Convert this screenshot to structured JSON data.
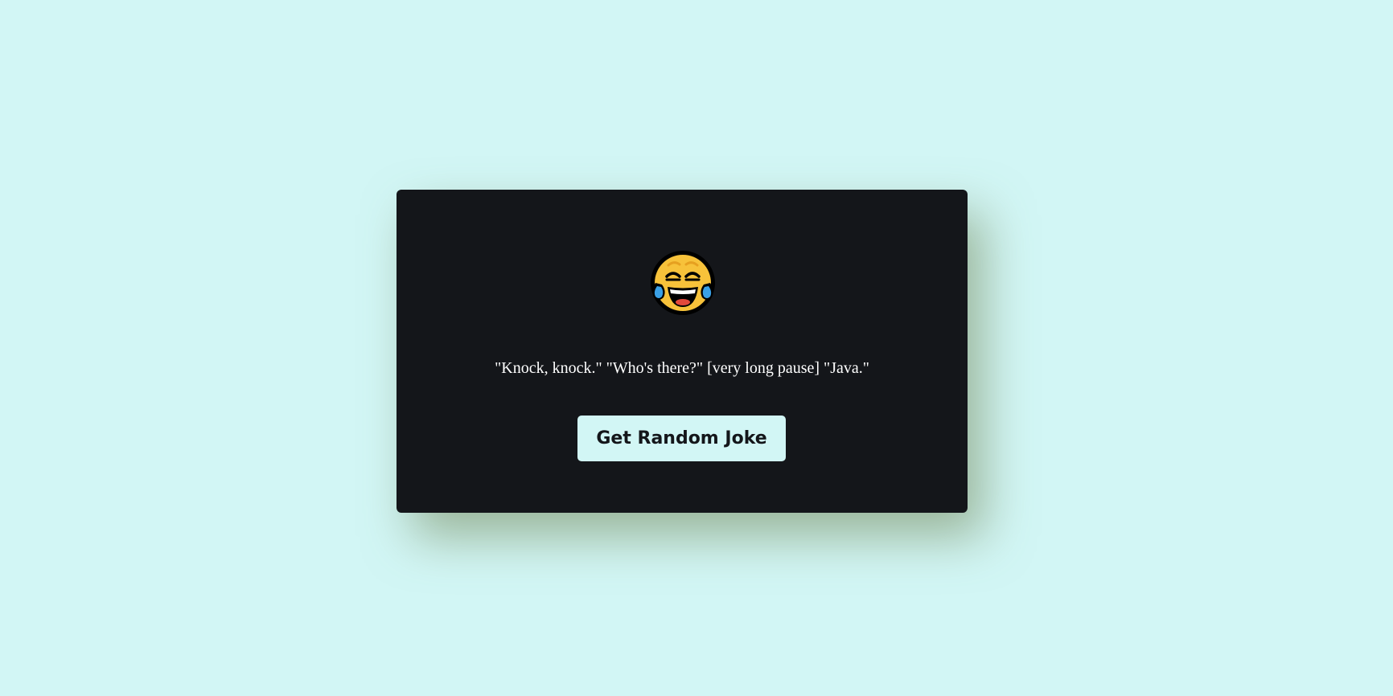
{
  "colors": {
    "page_background": "#d2f6f5",
    "card_background": "#14161a",
    "text": "#ffffff",
    "button_background": "#d2f6f5",
    "button_text": "#14161a"
  },
  "card": {
    "icon": "face-with-tears-of-joy-icon",
    "joke": "\"Knock, knock.\" \"Who's there?\" [very long pause] \"Java.\"",
    "button_label": "Get Random Joke"
  }
}
